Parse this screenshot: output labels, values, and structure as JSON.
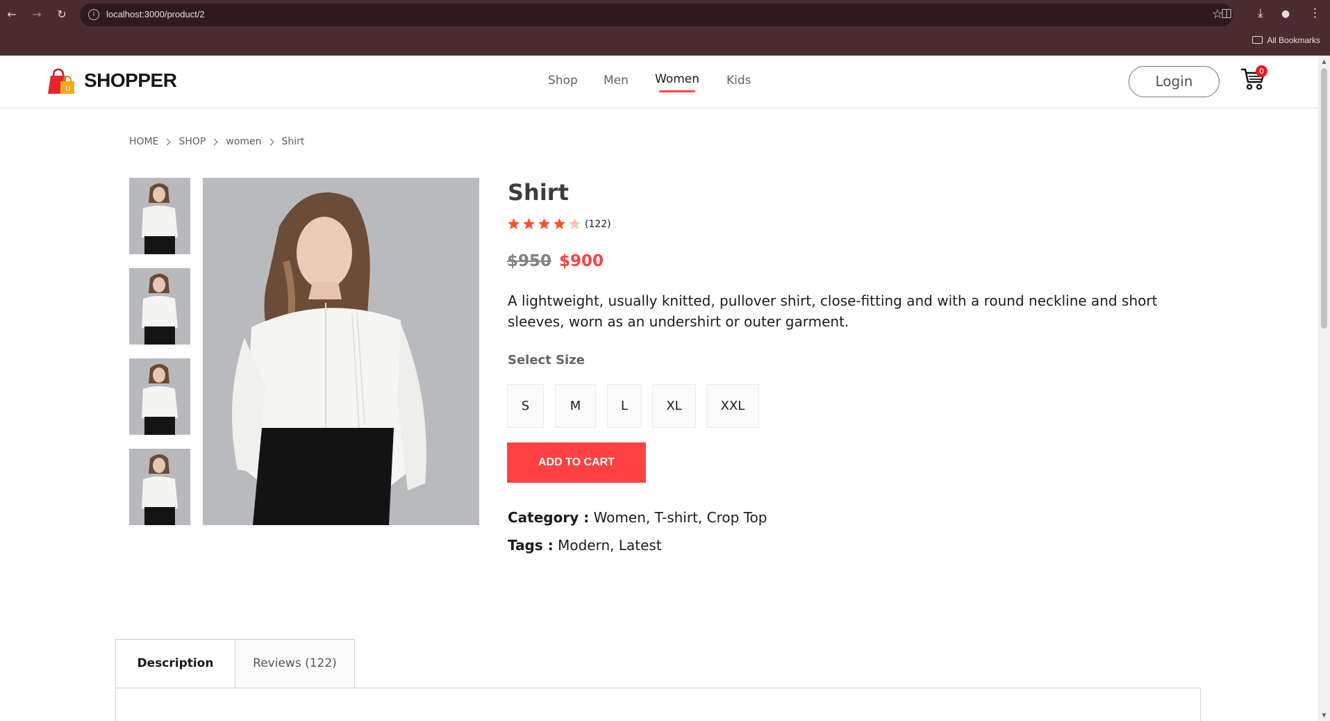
{
  "browser": {
    "url": "localhost:3000/product/2",
    "bookmarks_label": "All Bookmarks"
  },
  "navbar": {
    "brand": "SHOPPER",
    "menu": [
      {
        "label": "Shop"
      },
      {
        "label": "Men"
      },
      {
        "label": "Women"
      },
      {
        "label": "Kids"
      }
    ],
    "active_menu": "Women",
    "login_label": "Login",
    "cart_count": "0",
    "accent": "#ff4141"
  },
  "breadcrumb": [
    "HOME",
    "SHOP",
    "women",
    "Shirt"
  ],
  "product": {
    "name": "Shirt",
    "rating": 4,
    "rating_max": 5,
    "review_count": "(122)",
    "old_price": "$950",
    "new_price": "$900",
    "description": "A lightweight, usually knitted, pullover shirt, close-fitting and with a round neckline and short sleeves, worn as an undershirt or outer garment.",
    "size_label": "Select Size",
    "sizes": [
      "S",
      "M",
      "L",
      "XL",
      "XXL"
    ],
    "add_to_cart": "ADD TO CART",
    "category_label": "Category :",
    "category_value": "Women, T-shirt, Crop Top",
    "tags_label": "Tags :",
    "tags_value": "Modern, Latest"
  },
  "tabs": [
    {
      "label": "Description"
    },
    {
      "label": "Reviews (122)"
    }
  ]
}
